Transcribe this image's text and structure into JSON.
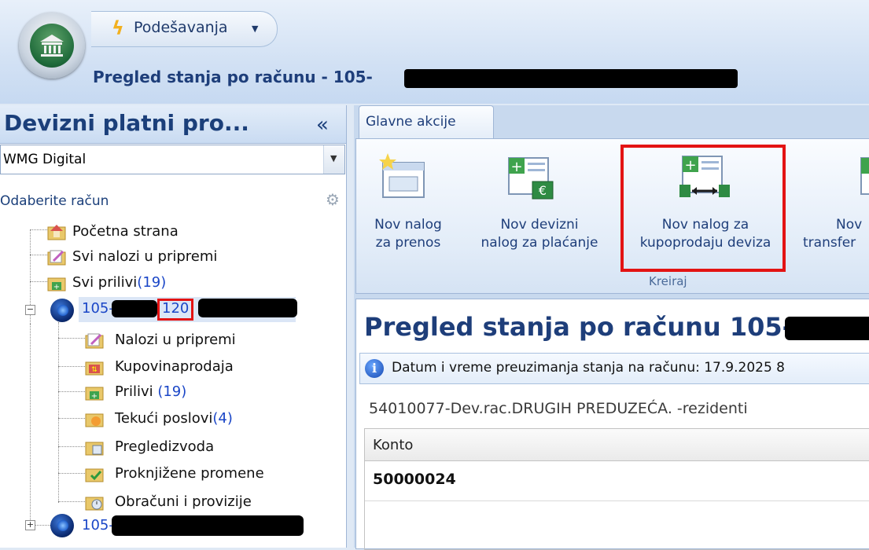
{
  "quick_access": {
    "label": "Podešavanja",
    "dropdown_arrow": "▼"
  },
  "document_title": {
    "prefix": "Pregled stanja po računu - 105-"
  },
  "left_pane": {
    "title": "Devizni platni pro...",
    "collapse_symbol": "«",
    "company": "WMG Digital",
    "select_account_label": "Odaberite račun",
    "items": [
      {
        "label": "Početna strana",
        "icon": "home-folder-icon"
      },
      {
        "label": "Svi nalozi u pripremi",
        "icon": "edit-folder-icon"
      },
      {
        "label": "Svi prilivi",
        "count": "(19)",
        "icon": "inflow-folder-icon"
      }
    ],
    "account1": {
      "prefix": "105-",
      "highlight": "120",
      "children": [
        {
          "label": "Nalozi u pripremi",
          "icon": "edit-folder-icon"
        },
        {
          "label": "Kupovinaprodaja",
          "icon": "exchange-folder-icon"
        },
        {
          "label": "Prilivi ",
          "count": "(19)",
          "icon": "inflow-folder-icon"
        },
        {
          "label": "Tekući poslovi",
          "count": "(4)",
          "icon": "current-folder-icon"
        },
        {
          "label": "Pregledizvoda",
          "icon": "statement-folder-icon"
        },
        {
          "label": "Proknjižene promene",
          "icon": "posted-folder-icon"
        },
        {
          "label": "Obračuni i provizije",
          "icon": "fees-folder-icon"
        }
      ]
    },
    "account2": {
      "prefix": "105-"
    }
  },
  "ribbon": {
    "tab": "Glavne akcije",
    "group_label": "Kreiraj",
    "buttons": [
      {
        "line1": "Nov nalog",
        "line2": "za prenos",
        "icon": "new-transfer-order-icon"
      },
      {
        "line1": "Nov devizni",
        "line2": "nalog za plaćanje",
        "icon": "new-fx-payment-icon"
      },
      {
        "line1": "Nov nalog za",
        "line2": "kupoprodaju deviza",
        "icon": "new-fx-exchange-icon"
      },
      {
        "line1": "Nov",
        "line2": "transfer",
        "icon": "new-transfer-icon"
      }
    ]
  },
  "content": {
    "title": "Pregled stanja po računu 105-",
    "info_text": "Datum i vreme preuzimanja stanja na računu: 17.9.2025 8",
    "account_description": "54010077-Dev.rac.DRUGIH PREDUZEĆA. -rezidenti",
    "grid": {
      "column_header": "Konto",
      "rows": [
        "50000024"
      ]
    }
  },
  "colors": {
    "highlight_border": "#e31313",
    "header_text": "#1e3e7a",
    "count_text": "#1a46c7"
  }
}
